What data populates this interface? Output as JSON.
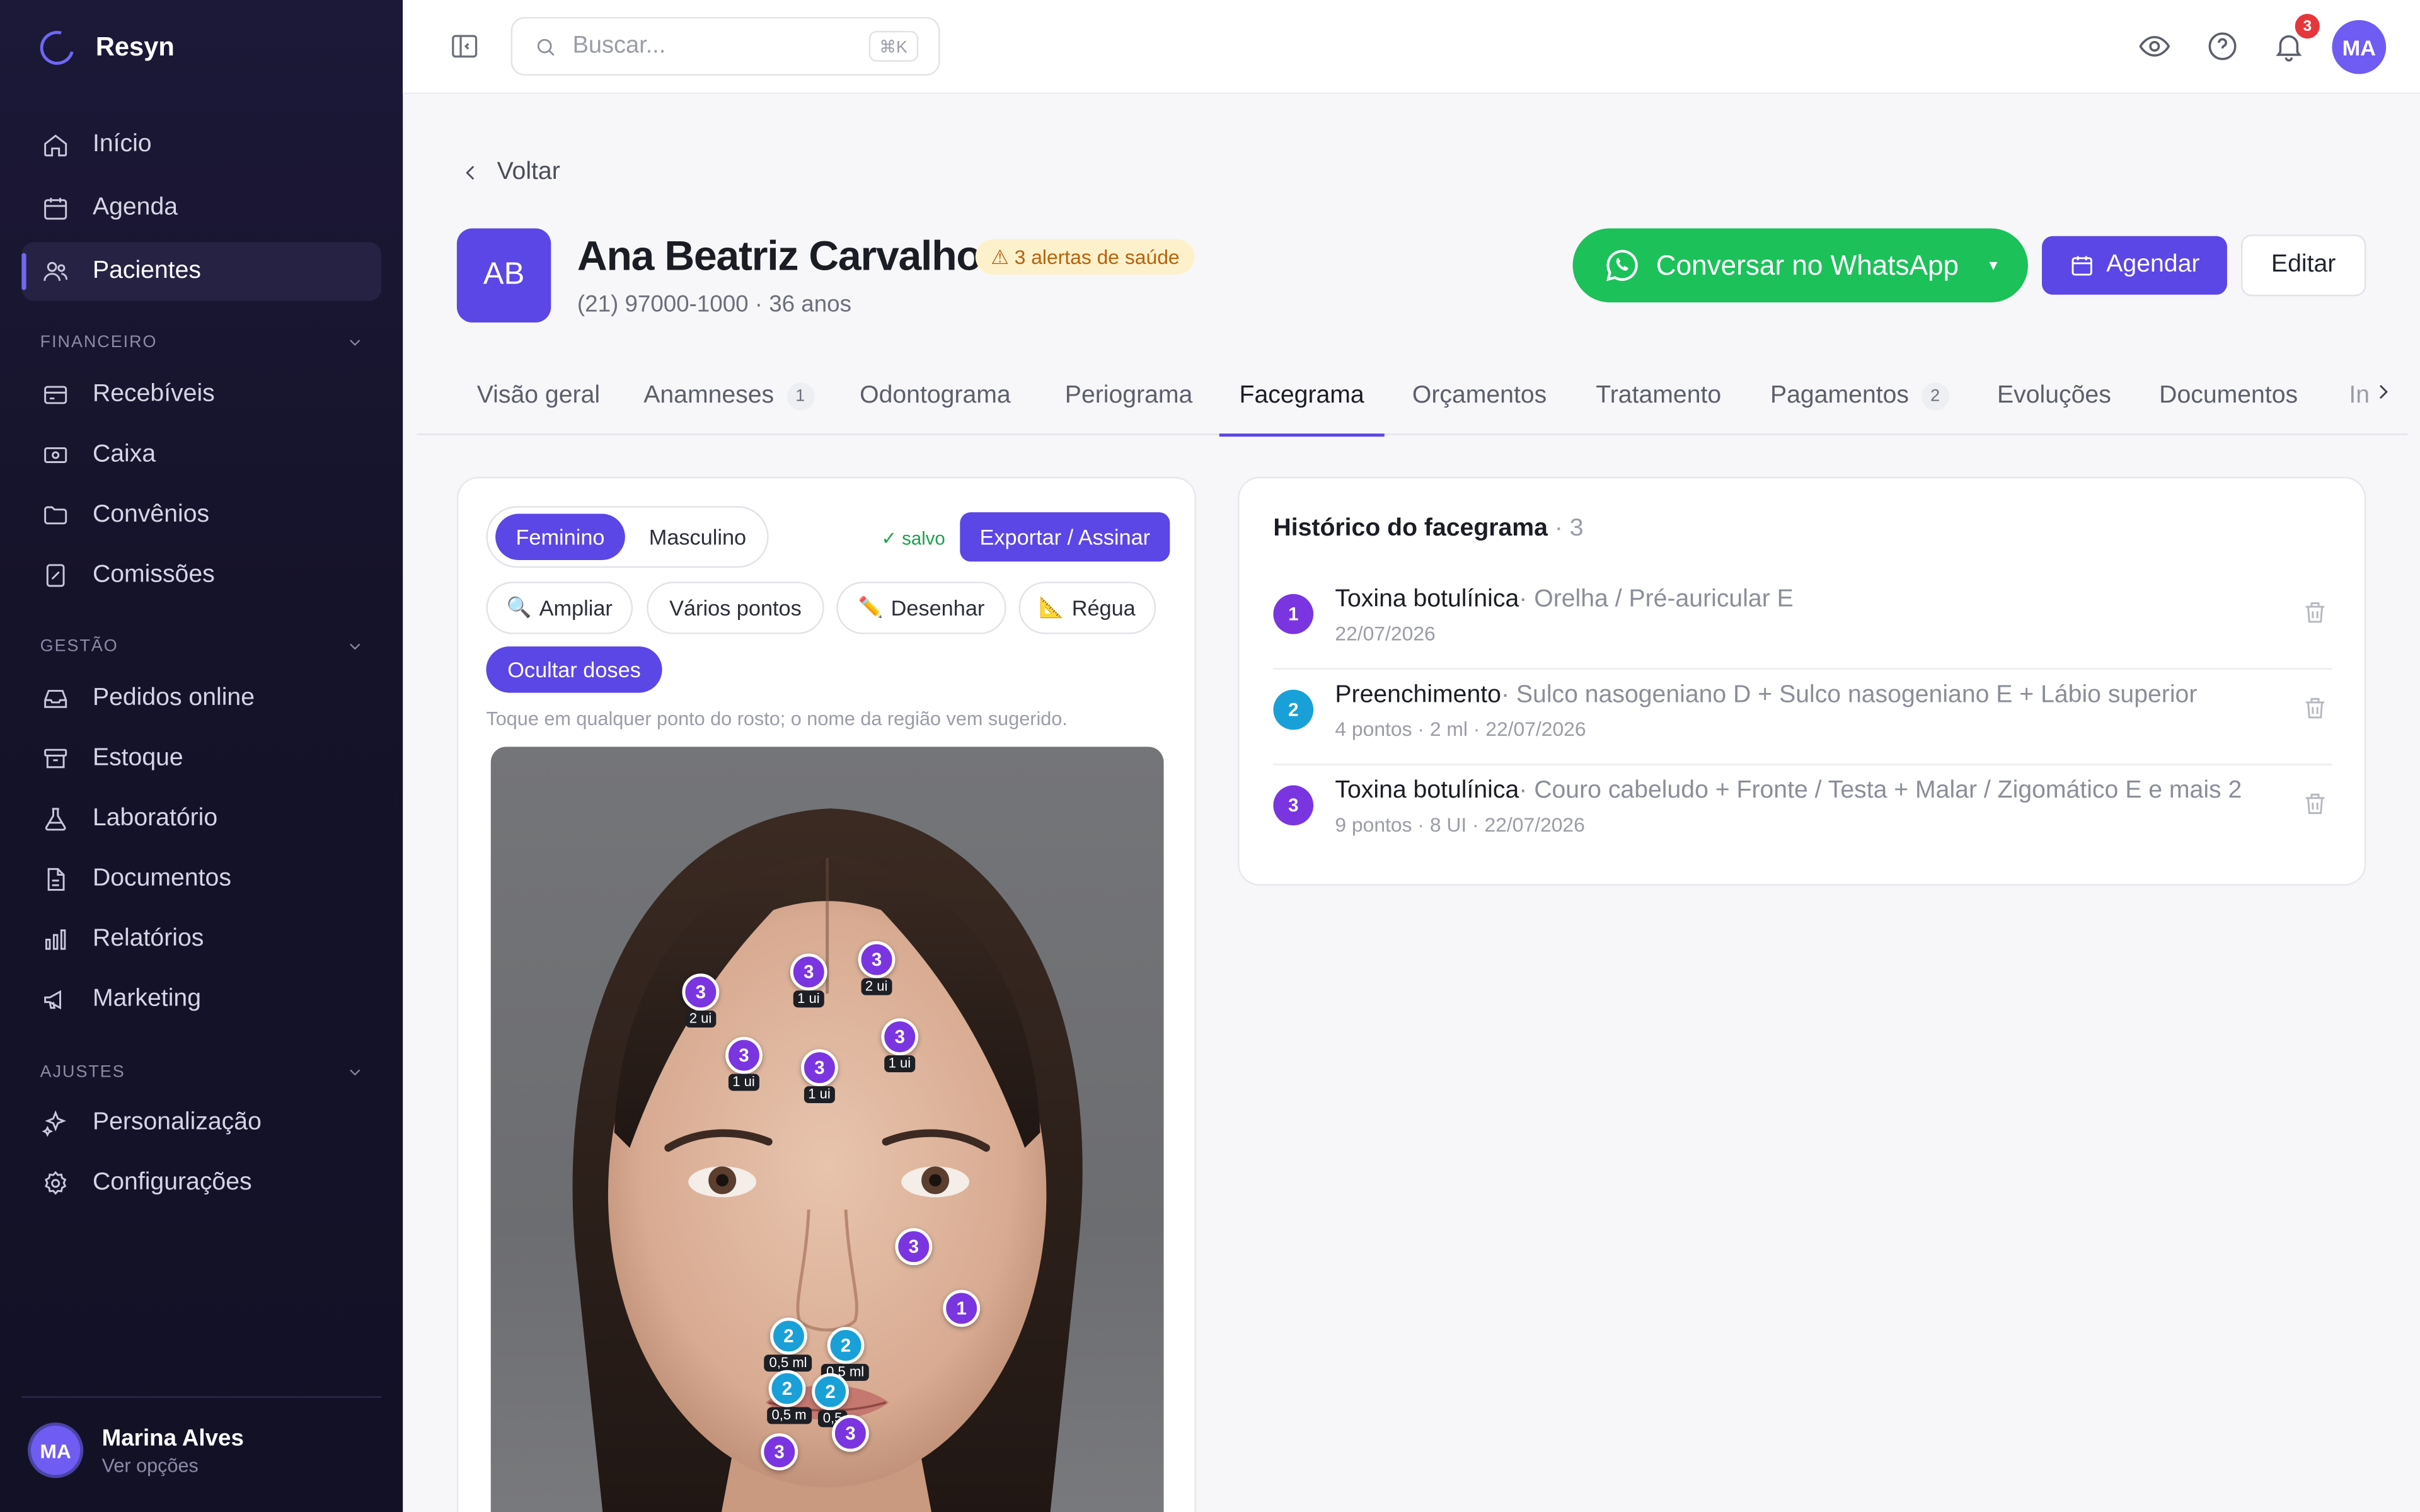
{
  "app": {
    "name": "Resyn"
  },
  "sidebar": {
    "items": [
      {
        "label": "Início",
        "icon": "home-icon"
      },
      {
        "label": "Agenda",
        "icon": "calendar-icon"
      },
      {
        "label": "Pacientes",
        "icon": "users-icon",
        "active": true
      }
    ],
    "sections": [
      {
        "label": "FINANCEIRO",
        "items": [
          {
            "label": "Recebíveis",
            "icon": "card-icon"
          },
          {
            "label": "Caixa",
            "icon": "cash-icon"
          },
          {
            "label": "Convênios",
            "icon": "folder-icon"
          },
          {
            "label": "Comissões",
            "icon": "percent-icon"
          }
        ]
      },
      {
        "label": "GESTÃO",
        "items": [
          {
            "label": "Pedidos online",
            "icon": "inbox-icon"
          },
          {
            "label": "Estoque",
            "icon": "archive-icon"
          },
          {
            "label": "Laboratório",
            "icon": "flask-icon"
          },
          {
            "label": "Documentos",
            "icon": "document-icon"
          },
          {
            "label": "Relatórios",
            "icon": "bar-chart-icon"
          },
          {
            "label": "Marketing",
            "icon": "megaphone-icon"
          }
        ]
      },
      {
        "label": "AJUSTES",
        "items": [
          {
            "label": "Personalização",
            "icon": "sparkles-icon"
          },
          {
            "label": "Configurações",
            "icon": "gear-icon"
          }
        ]
      }
    ],
    "user": {
      "initials": "MA",
      "name": "Marina Alves",
      "sub": "Ver opções"
    }
  },
  "topbar": {
    "search_placeholder": "Buscar...",
    "search_shortcut": "⌘K",
    "notifications_count": "3",
    "avatar_initials": "MA"
  },
  "header": {
    "back_label": "Voltar",
    "patient": {
      "initials": "AB",
      "name": "Ana Beatriz Carvalho",
      "alert": "⚠ 3 alertas de saúde",
      "sub": "(21) 97000-1000 · 36 anos"
    },
    "whatsapp_label": "Conversar no WhatsApp",
    "schedule_label": "Agendar",
    "edit_label": "Editar"
  },
  "tabs": [
    {
      "label": "Visão geral"
    },
    {
      "label": "Anamneses",
      "count": "1"
    },
    {
      "label": "Odontograma"
    },
    {
      "label": "Periograma"
    },
    {
      "label": "Facegrama",
      "active": true
    },
    {
      "label": "Orçamentos"
    },
    {
      "label": "Tratamento"
    },
    {
      "label": "Pagamentos",
      "count": "2"
    },
    {
      "label": "Evoluções"
    },
    {
      "label": "Documentos"
    },
    {
      "label": "In"
    }
  ],
  "facegram": {
    "sex_options": [
      "Feminino",
      "Masculino"
    ],
    "sex_selected": "Feminino",
    "saved_label": "✓ salvo",
    "export_label": "Exportar / Assinar",
    "tools": [
      "Ampliar",
      "Vários pontos",
      "Desenhar",
      "Régua"
    ],
    "hide_doses_label": "Ocultar doses",
    "hint": "Toque em qualquer ponto do rosto; o nome da região vem sugerido.",
    "points": [
      {
        "n": "3",
        "dose": "2 ui",
        "kind": "toxin"
      },
      {
        "n": "3",
        "dose": "1 ui",
        "kind": "toxin"
      },
      {
        "n": "3",
        "dose": "2 ui",
        "kind": "toxin"
      },
      {
        "n": "3",
        "dose": "1 ui",
        "kind": "toxin"
      },
      {
        "n": "3",
        "dose": "1 ui",
        "kind": "toxin"
      },
      {
        "n": "3",
        "dose": "1 ui",
        "kind": "toxin"
      },
      {
        "n": "3",
        "dose": "",
        "kind": "toxin"
      },
      {
        "n": "1",
        "dose": "",
        "kind": "toxin"
      },
      {
        "n": "2",
        "dose": "0,5 ml",
        "kind": "filler"
      },
      {
        "n": "2",
        "dose": "0,5 ml",
        "kind": "filler"
      },
      {
        "n": "2",
        "dose": "0,5 m",
        "kind": "filler"
      },
      {
        "n": "2",
        "dose": "0,5",
        "kind": "filler"
      },
      {
        "n": "3",
        "dose": "",
        "kind": "toxin"
      },
      {
        "n": "3",
        "dose": "",
        "kind": "toxin"
      }
    ]
  },
  "history": {
    "title": "Histórico do facegrama",
    "count": "· 3",
    "entries": [
      {
        "n": "1",
        "type": "Toxina botulínica",
        "region": "· Orelha / Pré-auricular E",
        "sub": "22/07/2026",
        "color": "#7a35e0"
      },
      {
        "n": "2",
        "type": "Preenchimento",
        "region": "· Sulco nasogeniano D + Sulco nasogeniano E + Lábio superior",
        "sub": "4 pontos · 2 ml · 22/07/2026",
        "color": "#19a0d8"
      },
      {
        "n": "3",
        "type": "Toxina botulínica",
        "region": "· Couro cabeludo + Fronte / Testa + Malar / Zigomático E e mais 2",
        "sub": "9 pontos · 8 UI · 22/07/2026",
        "color": "#7a35e0"
      }
    ]
  },
  "colors": {
    "accent": "#5b46e6",
    "whatsapp": "#1cc15a",
    "toxin": "#7a35e0",
    "filler": "#19a0d8"
  }
}
